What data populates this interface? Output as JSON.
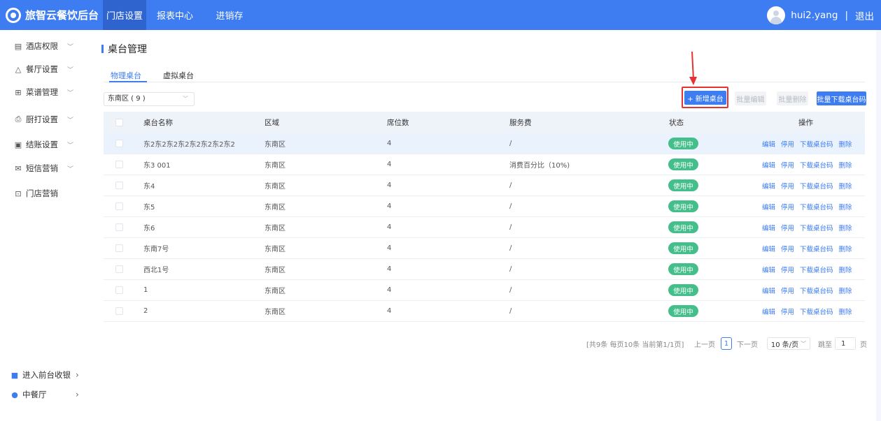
{
  "header": {
    "app_title": "旅智云餐饮后台",
    "nav": [
      "门店设置",
      "报表中心",
      "进销存"
    ],
    "active_nav": 0,
    "username": "hui2.yang",
    "separator": "|",
    "logout": "退出",
    "colors": {
      "bar": "#3d7cf1",
      "active": "#2f64cf"
    }
  },
  "sidebar": {
    "items": [
      {
        "icon": "hotel-icon",
        "label": "酒店权限",
        "expand": true
      },
      {
        "icon": "restaurant-icon",
        "label": "餐厅设置",
        "expand": true
      },
      {
        "icon": "menu-grid-icon",
        "label": "菜谱管理",
        "expand": true
      },
      {
        "icon": "printer-icon",
        "label": "厨打设置",
        "expand": true
      },
      {
        "icon": "checkout-icon",
        "label": "结账设置",
        "expand": true
      },
      {
        "icon": "mail-icon",
        "label": "短信营销",
        "expand": true
      },
      {
        "icon": "store-icon",
        "label": "门店营销",
        "expand": false
      }
    ],
    "bottom": [
      {
        "icon": "cashier-icon",
        "label": "进入前台收银"
      },
      {
        "icon": "location-icon",
        "label": "中餐厅"
      }
    ]
  },
  "page": {
    "title": "桌台管理",
    "tabs": [
      "物理桌台",
      "虚拟桌台"
    ],
    "active_tab": 0,
    "area_select": "东南区 ( 9 )",
    "buttons": {
      "add": "+ 新增桌台",
      "batch_edit": "批量编辑",
      "batch_delete": "批量删除",
      "batch_download": "批量下载桌台码"
    }
  },
  "table": {
    "columns": [
      "桌台名称",
      "区域",
      "席位数",
      "服务费",
      "状态",
      "操作"
    ],
    "rows": [
      {
        "name": "东2东2东2东2东2东2东2东2",
        "area": "东南区",
        "seats": "4",
        "fee": "/",
        "status": "使用中"
      },
      {
        "name": "东3 001",
        "area": "东南区",
        "seats": "4",
        "fee": "消费百分比（10%)",
        "status": "使用中"
      },
      {
        "name": "东4",
        "area": "东南区",
        "seats": "4",
        "fee": "/",
        "status": "使用中"
      },
      {
        "name": "东5",
        "area": "东南区",
        "seats": "4",
        "fee": "/",
        "status": "使用中"
      },
      {
        "name": "东6",
        "area": "东南区",
        "seats": "4",
        "fee": "/",
        "status": "使用中"
      },
      {
        "name": "东南7号",
        "area": "东南区",
        "seats": "4",
        "fee": "/",
        "status": "使用中"
      },
      {
        "name": "西北1号",
        "area": "东南区",
        "seats": "4",
        "fee": "/",
        "status": "使用中"
      },
      {
        "name": "1",
        "area": "东南区",
        "seats": "4",
        "fee": "/",
        "status": "使用中"
      },
      {
        "name": "2",
        "area": "东南区",
        "seats": "4",
        "fee": "/",
        "status": "使用中"
      }
    ],
    "actions": [
      "编辑",
      "停用",
      "下载桌台码",
      "删除"
    ],
    "status_color": "#44be8a"
  },
  "pagination": {
    "summary": "[共9条 每页10条 当前第1/1页]",
    "prev": "上一页",
    "current": "1",
    "next": "下一页",
    "page_size": "10 条/页",
    "jump_label": "跳至",
    "jump_value": "1",
    "page_unit": "页"
  }
}
